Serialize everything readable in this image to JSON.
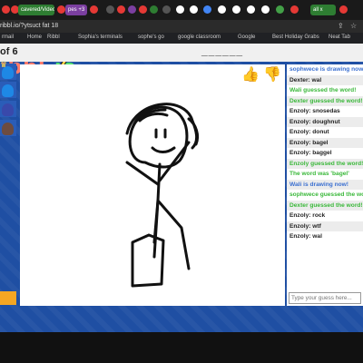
{
  "browser": {
    "tabs": [
      {
        "label": "cavered/Videos",
        "color": "#2e7d32"
      },
      {
        "label": "pes +3",
        "color": "#7b3fa0"
      },
      {
        "label": "all x",
        "color": "#2e7d32"
      }
    ],
    "url": "ribbl.io/?ytsuct fat 18",
    "bookmarks": [
      "rmail",
      "Home",
      "Ribbl",
      "Sophia's terminals",
      "sophe's go",
      "google classroom",
      "Google",
      "Best Holiday Grabs",
      "Neat Tab"
    ]
  },
  "game": {
    "logo": {
      "p1": "ibbl",
      "p2": ".",
      "p3": "io"
    },
    "round": "of 6",
    "word_hint": "______",
    "chat": {
      "messages": [
        {
          "text": "sophwece is drawing now!",
          "kind": "sys-blue"
        },
        {
          "text": "Dexter: wal",
          "kind": "normal"
        },
        {
          "text": "Wali guessed the word!",
          "kind": "sys-green"
        },
        {
          "text": "Dexter guessed the word!",
          "kind": "sys-green"
        },
        {
          "text": "Enzoly: snosedas",
          "kind": "normal"
        },
        {
          "text": "Enzoly: doughnut",
          "kind": "normal"
        },
        {
          "text": "Enzoly: donut",
          "kind": "normal"
        },
        {
          "text": "Enzoly: bagel",
          "kind": "normal"
        },
        {
          "text": "Enzoly: baggel",
          "kind": "normal"
        },
        {
          "text": "Enzoly guessed the word!",
          "kind": "sys-green"
        },
        {
          "text": "The word was 'bagel'",
          "kind": "sys-green"
        },
        {
          "text": "Wali is drawing now!",
          "kind": "sys-blue"
        },
        {
          "text": "sophwece guessed the word!",
          "kind": "sys-green"
        },
        {
          "text": "Dexter guessed the word!",
          "kind": "sys-green"
        },
        {
          "text": "Enzoly: rock",
          "kind": "normal"
        },
        {
          "text": "Enzoly: wtf",
          "kind": "normal"
        },
        {
          "text": "Enzoly: wal",
          "kind": "normal"
        }
      ],
      "input_placeholder": "Type your guess here..."
    },
    "colors": {
      "accent": "#1f4fa3",
      "guessed": "#3ab83a",
      "drawing": "#3a6fd0"
    }
  }
}
